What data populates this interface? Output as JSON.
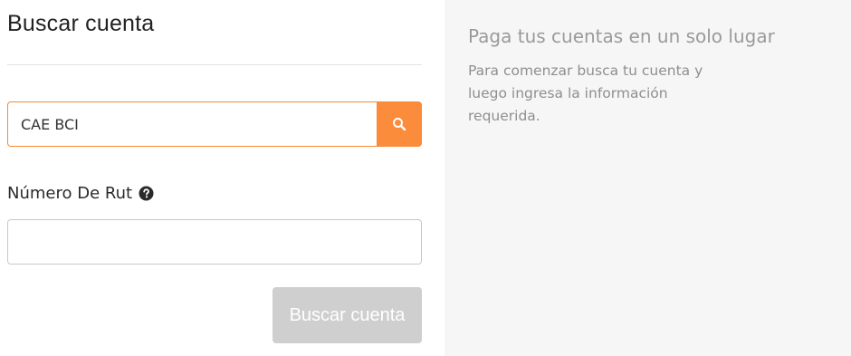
{
  "form": {
    "title": "Buscar cuenta",
    "search": {
      "value": "CAE BCI",
      "button_icon": "search-icon"
    },
    "rut": {
      "label": "Número De Rut",
      "help_icon": "question-circle-icon",
      "value": ""
    },
    "submit_label": "Buscar cuenta"
  },
  "info": {
    "title": "Paga tus cuentas en un solo lugar",
    "text": "Para comenzar busca tu cuenta y luego ingresa la información requerida."
  },
  "colors": {
    "accent": "#fb8c3c",
    "disabled_button": "#cfcfcf",
    "panel_bg": "#f6f6f6"
  }
}
